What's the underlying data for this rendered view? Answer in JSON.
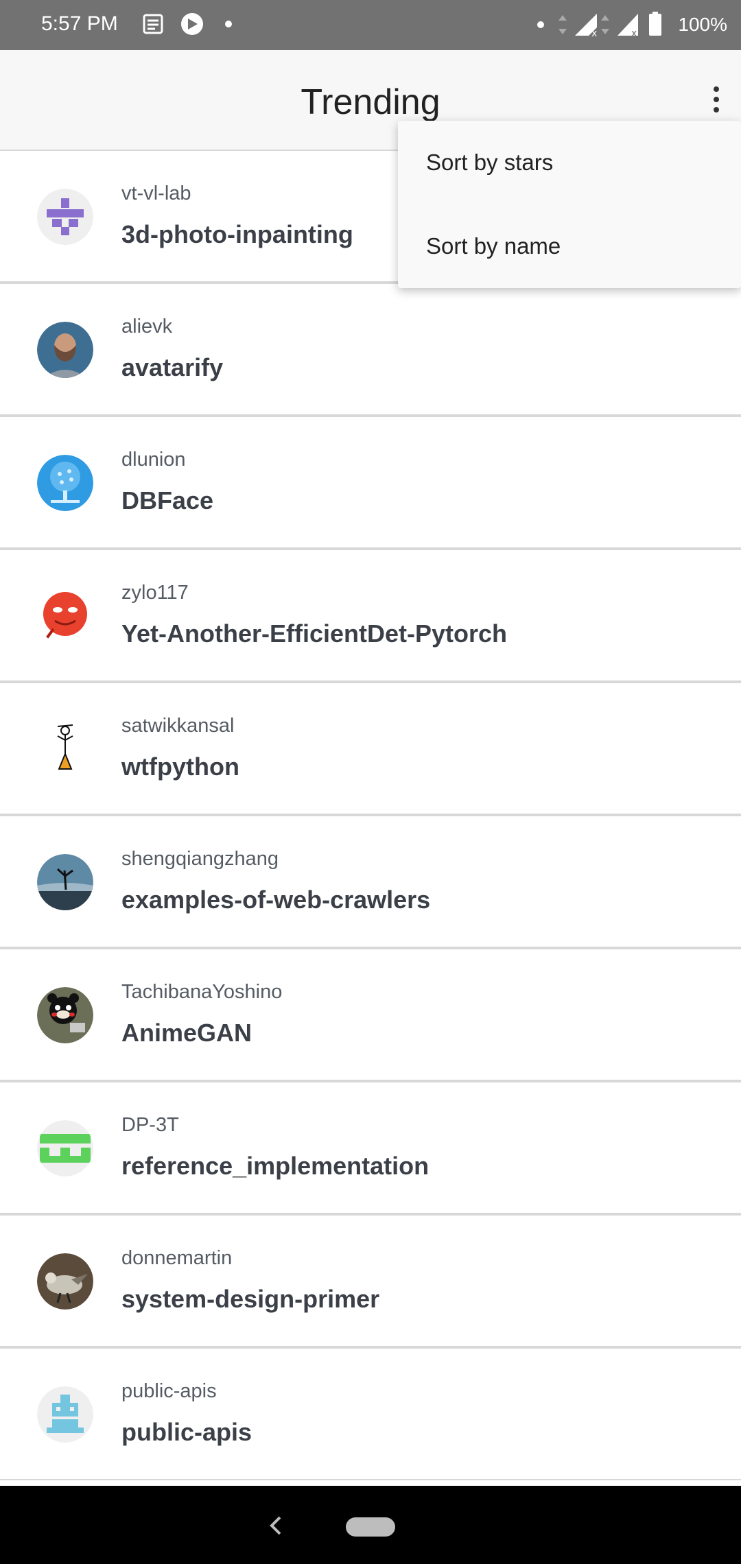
{
  "status_bar": {
    "time": "5:57 PM",
    "battery": "100%",
    "icons": [
      "news-icon",
      "play-icon",
      "dot-icon",
      "dot-icon",
      "data-arrows-icon",
      "signal-icon",
      "signal-icon",
      "battery-icon"
    ]
  },
  "app_bar": {
    "title": "Trending",
    "overflow_icon": "more-vert-icon"
  },
  "menu": {
    "items": [
      {
        "label": "Sort by stars"
      },
      {
        "label": "Sort by name"
      }
    ]
  },
  "repos": [
    {
      "owner": "vt-vl-lab",
      "name": "3d-photo-inpainting",
      "avatar": "identicon-purple"
    },
    {
      "owner": "alievk",
      "name": "avatarify",
      "avatar": "photo-man"
    },
    {
      "owner": "dlunion",
      "name": "DBFace",
      "avatar": "blue-tree"
    },
    {
      "owner": "zylo117",
      "name": "Yet-Another-EfficientDet-Pytorch",
      "avatar": "red-emoji"
    },
    {
      "owner": "satwikkansal",
      "name": "wtfpython",
      "avatar": "stick-figure"
    },
    {
      "owner": "shengqiangzhang",
      "name": "examples-of-web-crawlers",
      "avatar": "photo-beach"
    },
    {
      "owner": "TachibanaYoshino",
      "name": "AnimeGAN",
      "avatar": "photo-bear"
    },
    {
      "owner": "DP-3T",
      "name": "reference_implementation",
      "avatar": "identicon-green"
    },
    {
      "owner": "donnemartin",
      "name": "system-design-primer",
      "avatar": "photo-bird"
    },
    {
      "owner": "public-apis",
      "name": "public-apis",
      "avatar": "identicon-blue"
    }
  ],
  "nav_bar": {
    "back_icon": "back-icon",
    "home_icon": "home-pill-icon"
  }
}
